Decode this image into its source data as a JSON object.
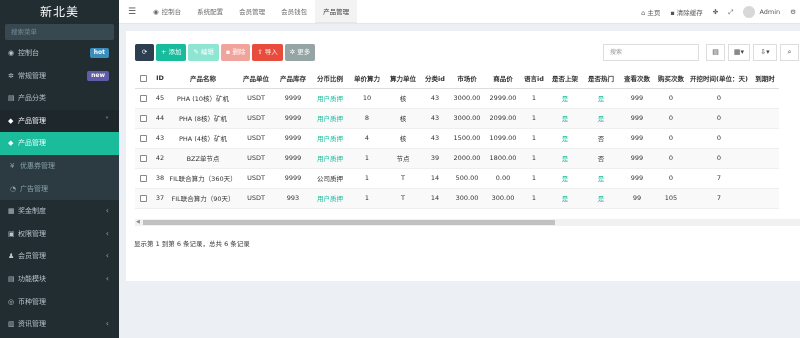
{
  "brand": "新北美",
  "sidebar": {
    "search_placeholder": "搜索菜单",
    "items": [
      {
        "label": "控制台",
        "icon": "dashboard-icon",
        "glyph": "◉",
        "badge": "hot",
        "badge_color": "#3c8dbc"
      },
      {
        "label": "常规管理",
        "icon": "cogs-icon",
        "glyph": "✲",
        "badge": "new",
        "badge_color": "#605ca8"
      },
      {
        "label": "产品分类",
        "icon": "folder-icon",
        "glyph": "▤"
      },
      {
        "label": "产品管理",
        "icon": "diamond-icon",
        "glyph": "◆",
        "chevron": "˅"
      },
      {
        "label": "产品管理",
        "icon": "diamond-icon",
        "glyph": "◆"
      },
      {
        "label": "优惠券管理",
        "icon": "coupon-icon",
        "glyph": "¥"
      },
      {
        "label": "广告管理",
        "icon": "ad-icon",
        "glyph": "◔"
      },
      {
        "label": "奖金制度",
        "icon": "bonus-icon",
        "glyph": "▦",
        "chevron": "‹"
      },
      {
        "label": "权限管理",
        "icon": "group-icon",
        "glyph": "▣",
        "chevron": "‹"
      },
      {
        "label": "会员管理",
        "icon": "user-icon",
        "glyph": "♟",
        "chevron": "‹"
      },
      {
        "label": "功能模块",
        "icon": "module-icon",
        "glyph": "▤",
        "chevron": "‹"
      },
      {
        "label": "币种管理",
        "icon": "coin-icon",
        "glyph": "◎"
      },
      {
        "label": "资讯管理",
        "icon": "news-icon",
        "glyph": "▥",
        "chevron": "‹"
      }
    ]
  },
  "header": {
    "tabs": [
      {
        "label": "控制台",
        "icon": "dashboard-icon",
        "glyph": "◉"
      },
      {
        "label": "系统配置",
        "glyph": ""
      },
      {
        "label": "会员管理",
        "glyph": ""
      },
      {
        "label": "会员钱包",
        "glyph": ""
      },
      {
        "label": "产品管理",
        "glyph": ""
      }
    ],
    "home": "主页",
    "clear_cache": "清除缓存",
    "user": "Admin"
  },
  "toolbar": {
    "refresh": "⟳",
    "add": "添加",
    "edit": "编辑",
    "delete": "删除",
    "import": "导入",
    "more": "更多",
    "search_placeholder": "搜索"
  },
  "table": {
    "columns": [
      "ID",
      "产品名称",
      "产品单位",
      "产品库存",
      "分币比例",
      "单价算力",
      "算力单位",
      "分类id",
      "市场价",
      "商品价",
      "语言id",
      "是否上架",
      "是否热门",
      "查看次数",
      "购买次数",
      "开挖时间(单位：天)",
      "到期时"
    ],
    "rows": [
      [
        "45",
        "PHA (10核）矿机",
        "USDT",
        "9999",
        "用户质押",
        "10",
        "核",
        "43",
        "3000.00",
        "2999.00",
        "1",
        "是",
        "是",
        "999",
        "0",
        "0",
        ""
      ],
      [
        "44",
        "PHA (8核）矿机",
        "USDT",
        "9999",
        "用户质押",
        "8",
        "核",
        "43",
        "3000.00",
        "2099.00",
        "1",
        "是",
        "是",
        "999",
        "0",
        "0",
        ""
      ],
      [
        "43",
        "PHA (4核）矿机",
        "USDT",
        "9999",
        "用户质押",
        "4",
        "核",
        "43",
        "1500.00",
        "1099.00",
        "1",
        "是",
        "否",
        "999",
        "0",
        "0",
        ""
      ],
      [
        "42",
        "BZZ单节点",
        "USDT",
        "9999",
        "用户质押",
        "1",
        "节点",
        "39",
        "2000.00",
        "1800.00",
        "1",
        "是",
        "否",
        "999",
        "0",
        "0",
        ""
      ],
      [
        "38",
        "FIL联合算力（360天）",
        "USDT",
        "9999",
        "公司质押",
        "1",
        "T",
        "14",
        "500.00",
        "0.00",
        "1",
        "是",
        "是",
        "999",
        "0",
        "7",
        ""
      ],
      [
        "37",
        "FIL联合算力（90天）",
        "USDT",
        "993",
        "用户质押",
        "1",
        "T",
        "14",
        "300.00",
        "300.00",
        "1",
        "是",
        "是",
        "99",
        "105",
        "7",
        ""
      ]
    ]
  },
  "pager_text": "显示第 1 到第 6 条记录，总共 6 条记录",
  "colors": {
    "accent": "#18bc9c",
    "sidebar": "#222d32",
    "danger": "#e74c3c"
  }
}
